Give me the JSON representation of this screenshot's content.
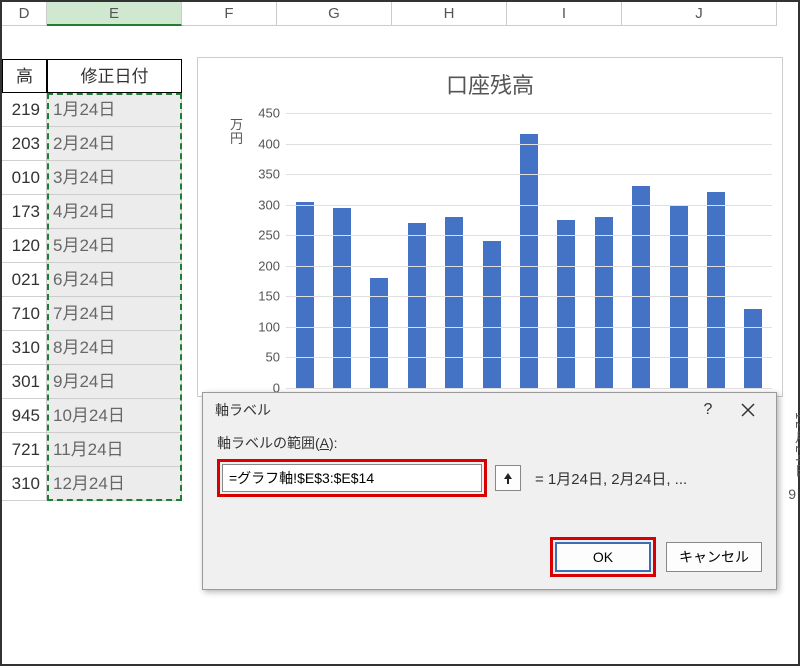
{
  "columns": {
    "D": "D",
    "E": "E",
    "F": "F",
    "G": "G",
    "H": "H",
    "I": "I",
    "J": "J"
  },
  "headers": {
    "d_tail": "高",
    "e": "修正日付"
  },
  "rows": [
    {
      "d": "219",
      "e": "1月24日"
    },
    {
      "d": "203",
      "e": "2月24日"
    },
    {
      "d": "010",
      "e": "3月24日"
    },
    {
      "d": "173",
      "e": "4月24日"
    },
    {
      "d": "120",
      "e": "5月24日"
    },
    {
      "d": "021",
      "e": "6月24日"
    },
    {
      "d": "710",
      "e": "7月24日"
    },
    {
      "d": "310",
      "e": "8月24日"
    },
    {
      "d": "301",
      "e": "9月24日"
    },
    {
      "d": "945",
      "e": "10月24日"
    },
    {
      "d": "721",
      "e": "11月24日"
    },
    {
      "d": "310",
      "e": "12月24日"
    }
  ],
  "chart": {
    "title": "口座残高",
    "y_unit_top": "万",
    "y_unit_bottom": "円",
    "visible_xlabel": "12月24日",
    "x_extra": "9"
  },
  "chart_data": {
    "type": "bar",
    "title": "口座残高",
    "xlabel": "",
    "ylabel": "万円",
    "ylim": [
      0,
      450
    ],
    "yticks": [
      0,
      50,
      100,
      150,
      200,
      250,
      300,
      350,
      400,
      450
    ],
    "categories": [
      "1月24日",
      "2月24日",
      "3月24日",
      "4月24日",
      "5月24日",
      "6月24日",
      "7月24日",
      "8月24日",
      "9月24日",
      "10月24日",
      "11月24日",
      "12月24日"
    ],
    "values": [
      305,
      295,
      180,
      270,
      280,
      240,
      415,
      275,
      280,
      330,
      300,
      320,
      130
    ]
  },
  "dialog": {
    "title": "軸ラベル",
    "label_prefix": "軸ラベルの範囲(",
    "label_accel": "A",
    "label_suffix": "):",
    "range_value": "=グラフ軸!$E$3:$E$14",
    "preview": "= 1月24日, 2月24日, ...",
    "ok": "OK",
    "cancel": "キャンセル"
  }
}
